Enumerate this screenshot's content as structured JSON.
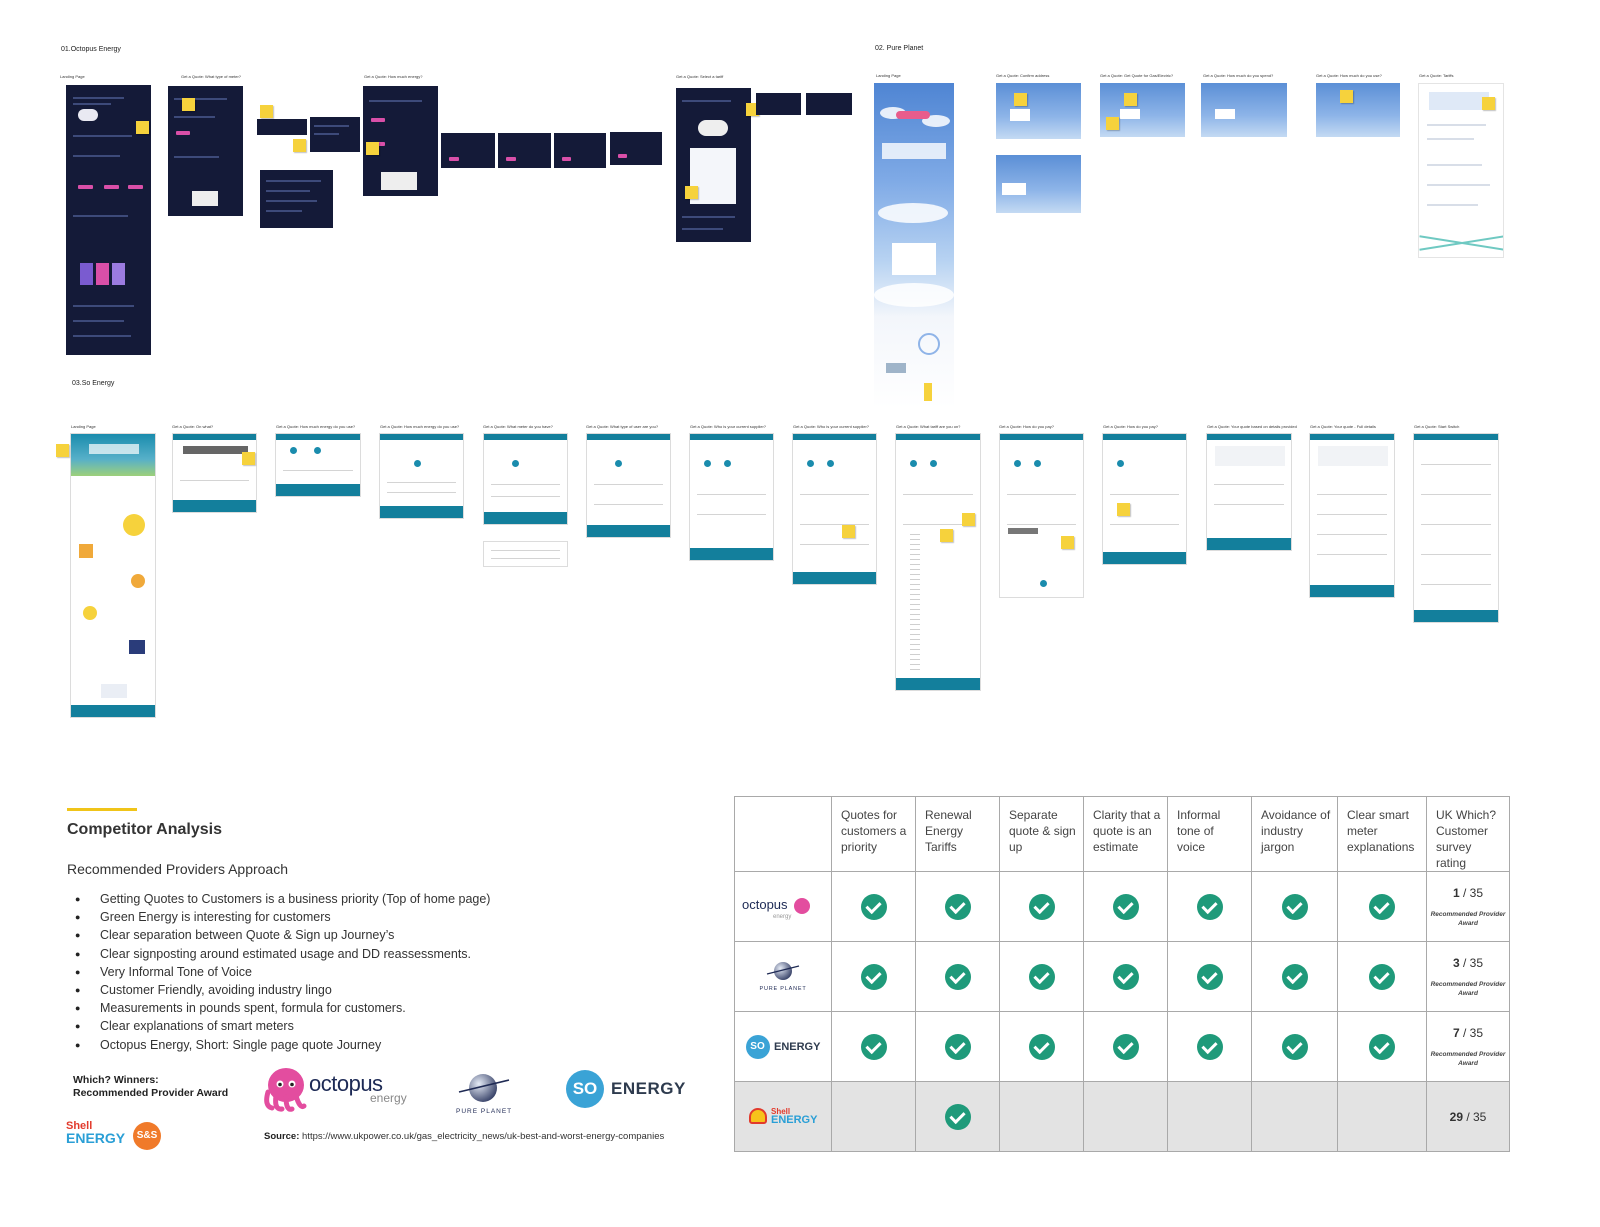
{
  "sections": {
    "octopus": "01.Octopus Energy",
    "pure_planet": "02. Pure Planet",
    "so": "03.So Energy"
  },
  "octopus_screens": [
    "Landing Page",
    "Get a Quote: What type of meter?",
    "Get a Quote: How much energy?",
    "Get a Quote: Select a tariff"
  ],
  "pure_planet_screens": [
    "Landing Page",
    "Get a Quote: Confirm address",
    "Get a Quote: Get Quote for Gas/Electric?",
    "Get a Quote: How much do you spend?",
    "Get a Quote: How much do you use?",
    "Get a Quote: Tariffs"
  ],
  "so_screens": [
    "Landing Page",
    "Get a Quote: On what?",
    "Get a Quote: How much energy do you use?",
    "Get a Quote: How much energy do you use?",
    "Get a Quote: What meter do you have?",
    "Get a Quote: What type of user are you?",
    "Get a Quote: Who is your current supplier?",
    "Get a Quote: Who is your current supplier?",
    "Get a Quote: What tariff are you on?",
    "Get a Quote: How do you pay?",
    "Get a Quote: How do you pay?",
    "Get a Quote: Your quote based on details provided",
    "Get a Quote: Your quote - Full details",
    "Get a Quote: Start Switch"
  ],
  "analysis": {
    "title": "Competitor Analysis",
    "subtitle": "Recommended Providers Approach",
    "bullets": [
      "Getting Quotes to Customers is a business priority (Top of home page)",
      "Green Energy is interesting for customers",
      "Clear separation between Quote & Sign up Journey’s",
      "Clear signposting around estimated usage and DD reassessments.",
      "Very Informal Tone of Voice",
      "Customer Friendly, avoiding industry lingo",
      "Measurements in pounds spent, formula for customers.",
      "Clear explanations of smart meters",
      "Octopus Energy, Short: Single page quote Journey"
    ],
    "winners_line1": "Which? Winners:",
    "winners_line2": "Recommended Provider Award",
    "source_label": "Source:",
    "source_url": "https://www.ukpower.co.uk/gas_electricity_news/uk-best-and-worst-energy-companies"
  },
  "logos": {
    "octopus": "octopus",
    "octopus_sub": "energy",
    "pure_planet": "PURE PLANET",
    "so": "SO",
    "so_word": "ENERGY",
    "shell_line1": "Shell",
    "shell_line2": "ENERGY",
    "ss": "S&S"
  },
  "table": {
    "headers": [
      "Quotes for customers a priority",
      "Renewal Energy Tariffs",
      "Separate quote & sign up",
      "Clarity that a quote is an estimate",
      "Informal tone of voice",
      "Avoidance of industry jargon",
      "Clear smart meter explanations",
      "UK Which? Customer survey rating"
    ],
    "rows": [
      {
        "provider": "Octopus Energy",
        "checks": [
          true,
          true,
          true,
          true,
          true,
          true,
          true
        ],
        "rank": "1",
        "total": " / 35",
        "award": "Recommended Provider Award"
      },
      {
        "provider": "Pure Planet",
        "checks": [
          true,
          true,
          true,
          true,
          true,
          true,
          true
        ],
        "rank": "3",
        "total": " / 35",
        "award": "Recommended Provider Award"
      },
      {
        "provider": "So Energy",
        "checks": [
          true,
          true,
          true,
          true,
          true,
          true,
          true
        ],
        "rank": "7",
        "total": " / 35",
        "award": "Recommended Provider Award"
      },
      {
        "provider": "Shell Energy",
        "checks": [
          false,
          true,
          false,
          false,
          false,
          false,
          false
        ],
        "rank": "29",
        "total": " / 35",
        "award": ""
      }
    ]
  },
  "colors": {
    "accent": "#f0c419",
    "check": "#1f9a7a",
    "octopus_dark": "#141a38",
    "octopus_pink": "#d94fa8",
    "so_teal": "#137f9c",
    "sticky": "#f6d23c"
  }
}
